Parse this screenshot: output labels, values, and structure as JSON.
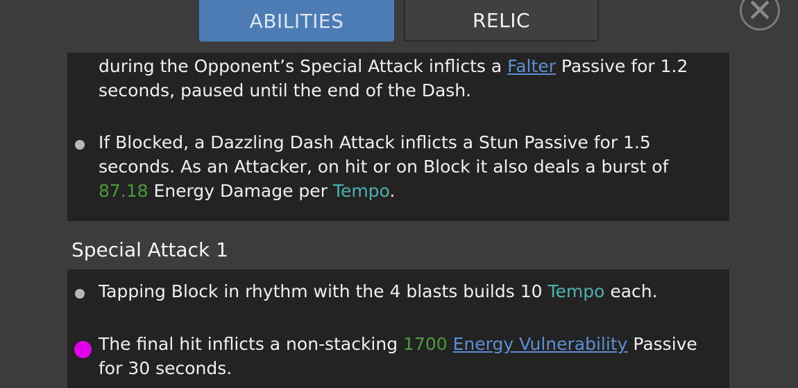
{
  "tabs": {
    "abilities": "ABILITIES",
    "relic": "RELIC"
  },
  "close_icon": "close-icon",
  "top_panel": {
    "para1": {
      "t1": "during the Opponent’s Special Attack inflicts a ",
      "link": "Falter",
      "t2": " Passive for 1.2 seconds, paused until the end of the Dash."
    },
    "para2": {
      "t1": "If Blocked, a Dazzling Dash Attack inflicts a Stun Passive for 1.5 seconds. As an Attacker, on hit or on Block it also deals a burst of ",
      "num": "87.18",
      "t2": " Energy Damage per ",
      "keyword": "Tempo",
      "t3": "."
    }
  },
  "section_title": "Special Attack 1",
  "bottom_panel": {
    "para1": {
      "t1": "Tapping Block in rhythm with the 4 blasts builds 10 ",
      "keyword": "Tempo",
      "t2": " each."
    },
    "para2": {
      "t1": "The final hit inflicts a non-stacking ",
      "num": "1700",
      "t2": " ",
      "link": "Energy Vulnerability",
      "t3": " Passive for 30 seconds."
    }
  },
  "colors": {
    "accent_tab": "#4d7bb3",
    "value_green": "#4d9a3d",
    "keyword_teal": "#4fb0b0",
    "link_blue": "#5f8fd2",
    "marker_magenta": "#e000e8"
  }
}
